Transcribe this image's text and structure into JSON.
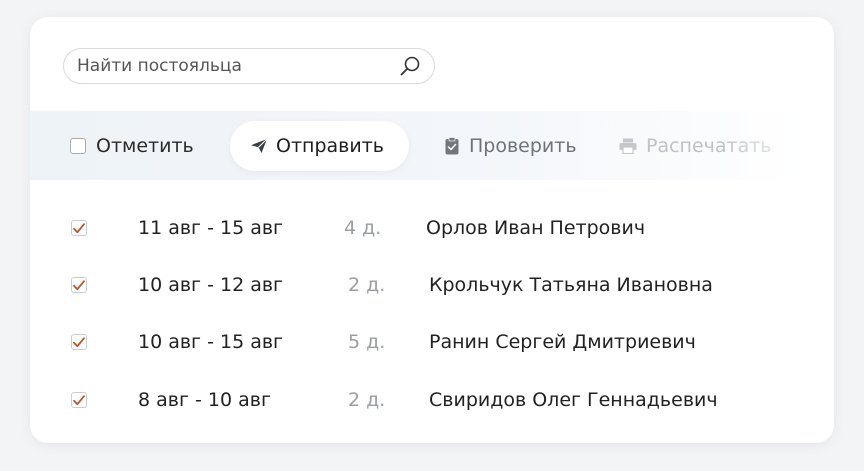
{
  "search": {
    "placeholder": "Найти постояльца"
  },
  "toolbar": {
    "mark_label": "Отметить",
    "send_label": "Отправить",
    "check_label": "Проверить",
    "print_label": "Распечатать"
  },
  "rows": [
    {
      "checked": true,
      "dates": "11 авг - 15 авг",
      "days": "4 д.",
      "name": "Орлов Иван Петрович"
    },
    {
      "checked": true,
      "dates": "10 авг - 12 авг",
      "days": "2 д.",
      "name": "Крольчук Татьяна Ивановна"
    },
    {
      "checked": true,
      "dates": "10 авг - 15 авг",
      "days": "5 д.",
      "name": "Ранин Сергей Дмитриевич"
    },
    {
      "checked": true,
      "dates": "8 авг - 10 авг",
      "days": "2 д.",
      "name": "Свиридов Олег Геннадьевич"
    }
  ],
  "colors": {
    "checkmark": "#c0522a",
    "send_icon": "#3a3f45",
    "check_icon": "#74787d",
    "print_icon": "#c4c7cb"
  },
  "icons": {
    "search": "magnifier-icon",
    "send": "paper-plane-icon",
    "check": "clipboard-icon",
    "print": "printer-icon",
    "row_check": "checkmark-icon"
  }
}
